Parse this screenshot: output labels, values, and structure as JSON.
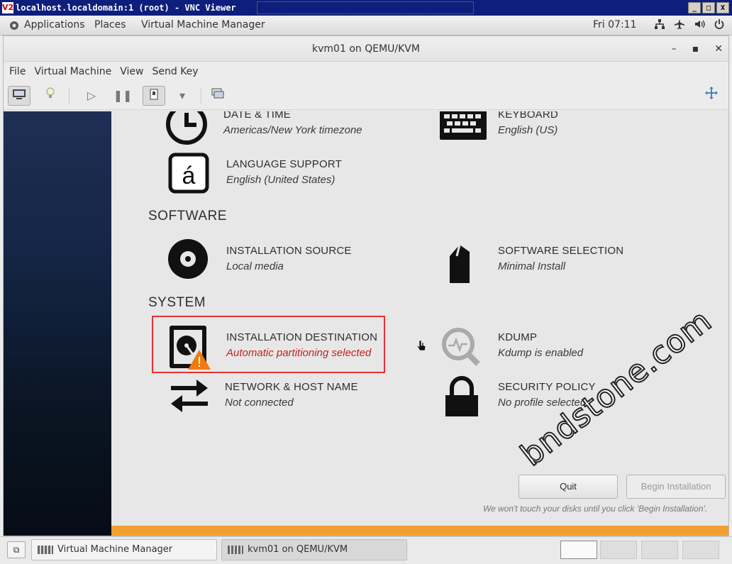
{
  "vnc": {
    "title": "localhost.localdomain:1 (root) - VNC Viewer",
    "logo": "V2",
    "buttons": [
      "_",
      "□",
      "X"
    ]
  },
  "gnome": {
    "applications": "Applications",
    "places": "Places",
    "vmm": "Virtual Machine Manager",
    "clock": "Fri 07:11",
    "tray_icons": [
      "network-icon",
      "airplane-icon",
      "volume-icon",
      "power-icon"
    ]
  },
  "window": {
    "title": "kvm01 on QEMU/KVM",
    "controls": [
      "minimize",
      "maximize",
      "close"
    ]
  },
  "menubar": {
    "items": [
      "File",
      "Virtual Machine",
      "View",
      "Send Key"
    ]
  },
  "installer": {
    "localization": [
      {
        "title": "DATE & TIME",
        "status": "Americas/New York timezone",
        "icon": "clock-icon"
      },
      {
        "title": "KEYBOARD",
        "status": "English (US)",
        "icon": "keyboard-icon"
      },
      {
        "title": "LANGUAGE SUPPORT",
        "status": "English (United States)",
        "icon": "language-icon"
      }
    ],
    "software_heading": "SOFTWARE",
    "software": [
      {
        "title": "INSTALLATION SOURCE",
        "status": "Local media",
        "icon": "disc-icon"
      },
      {
        "title": "SOFTWARE SELECTION",
        "status": "Minimal Install",
        "icon": "package-icon"
      }
    ],
    "system_heading": "SYSTEM",
    "system": [
      {
        "title": "INSTALLATION DESTINATION",
        "status": "Automatic partitioning selected",
        "icon": "harddisk-warning-icon",
        "warning": true
      },
      {
        "title": "KDUMP",
        "status": "Kdump is enabled",
        "icon": "kdump-search-icon"
      },
      {
        "title": "NETWORK & HOST NAME",
        "status": "Not connected",
        "icon": "network-arrows-icon"
      },
      {
        "title": "SECURITY POLICY",
        "status": "No profile selected",
        "icon": "lock-icon"
      }
    ],
    "quit_label": "Quit",
    "begin_label": "Begin Installation",
    "note": "We won't touch your disks until you click 'Begin Installation'."
  },
  "watermark": "bndstone.com",
  "taskbar": {
    "tasks": [
      "Virtual Machine Manager",
      "kvm01 on QEMU/KVM"
    ],
    "workspaces": 4
  },
  "colors": {
    "vnc_title": "#0d1e7c",
    "warning_text": "#c4211f",
    "highlight": "#e43232",
    "warning_bar": "#f0a030"
  }
}
